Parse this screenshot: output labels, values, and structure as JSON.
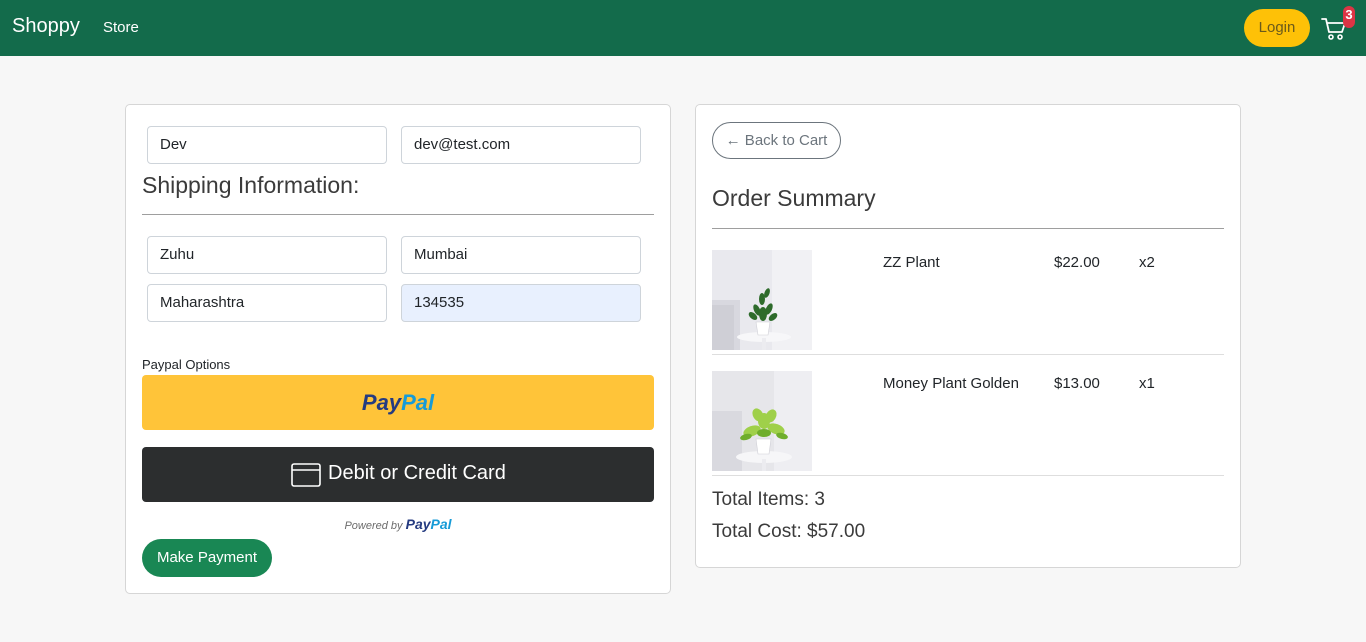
{
  "nav": {
    "brand": "Shoppy",
    "store": "Store",
    "login": "Login",
    "cart_count": "3"
  },
  "form": {
    "name": "Dev",
    "email": "dev@test.com",
    "shipping_title": "Shipping Information:",
    "address": "Zuhu",
    "city": "Mumbai",
    "state": "Maharashtra",
    "zipcode": "134535"
  },
  "payment": {
    "label": "Paypal Options",
    "paypal_dark": "Pay",
    "paypal_light": "Pal",
    "card_button": "Debit or Credit Card",
    "powered_by": "Powered by",
    "make_payment": "Make Payment"
  },
  "summary": {
    "back": "← Back to Cart",
    "title": "Order Summary",
    "items": [
      {
        "name": "ZZ Plant",
        "price": "$22.00",
        "qty": "x2"
      },
      {
        "name": "Money Plant Golden",
        "price": "$13.00",
        "qty": "x1"
      }
    ],
    "total_items": "Total Items: 3",
    "total_cost": "Total Cost: $57.00"
  },
  "colors": {
    "navbar": "#136b4b",
    "login": "#fec107",
    "paypal": "#ffc439",
    "card": "#2c2e2f",
    "pay": "#198754"
  },
  "icons": {
    "cart": "cart-icon",
    "card": "credit-card-icon"
  }
}
